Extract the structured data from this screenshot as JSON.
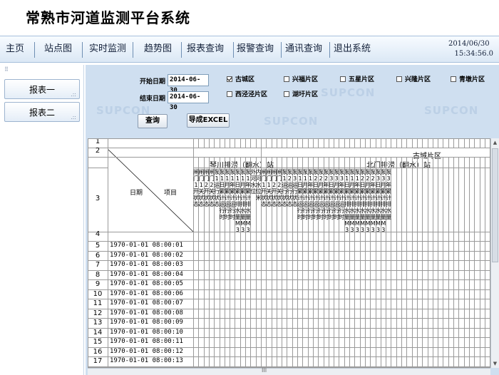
{
  "app": {
    "title": "常熟市河道监测平台系统"
  },
  "nav": {
    "items": [
      "主页",
      "站点图",
      "实时监测",
      "趋势图",
      "报表查询",
      "报警查询",
      "通讯查询",
      "退出系统"
    ],
    "date": "2014/06/30",
    "time": "15:34:56.0"
  },
  "sidebar": {
    "items": [
      "报表一",
      "报表二"
    ]
  },
  "watermark": "SUPCON",
  "form": {
    "start_label": "开始日期",
    "start_value": "2014-06-30",
    "end_label": "结束日期",
    "end_value": "2014-06-30",
    "districts": [
      {
        "label": "古城区",
        "checked": true
      },
      {
        "label": "兴福片区",
        "checked": false
      },
      {
        "label": "五星片区",
        "checked": false
      },
      {
        "label": "兴隆片区",
        "checked": false
      },
      {
        "label": "青墩片区",
        "checked": false
      },
      {
        "label": "西泾泾片区",
        "checked": false
      },
      {
        "label": "湖圩片区",
        "checked": false
      }
    ],
    "query_button": "查询",
    "export_button": "导成EXCEL"
  },
  "sheet": {
    "header_rows": [
      "1",
      "2",
      "3",
      "4"
    ],
    "district_title": "古城片区",
    "station1": "琴川排涝（翻水）站",
    "station2": "北门排涝（翻水）站",
    "diag_date": "日期",
    "diag_item": "项目",
    "station1_cols": [
      "闸门1开状态",
      "闸门1关状态",
      "闸门2开状态",
      "闸门2关状态",
      "泵1运行状态",
      "泵1日累计运行时",
      "泵1月累计运行时",
      "泵1年累计运行时",
      "泵1日累计排水量M3",
      "泵1月累计排水量M3",
      "泵1年累计排水量M3",
      "外河水位",
      "内河水位米"
    ],
    "station2_cols": [
      "闸门1开状态",
      "闸门1关状态",
      "闸门2开状态",
      "闸门2关状态",
      "泵1运行状态",
      "泵2运行状态",
      "泵3运行状态",
      "泵1日累计运行时",
      "泵1月累计运行时",
      "泵1年累计运行时",
      "泵2日累计运行时",
      "泵2月累计运行时",
      "泵2年累计运行时",
      "泵3日累计运行时",
      "泵3月累计运行时",
      "泵3年累计运行时",
      "泵1日累计排水量M3",
      "泵1月累计排水量M3",
      "泵1年累计排水量M3",
      "泵2日累计排水量M3",
      "泵2月累计排水量M3",
      "泵2年累计排水量M3",
      "泵3日累计排水量M3",
      "泵3月累计排水量M3",
      "泵3年累计排水量"
    ],
    "rows": [
      {
        "num": "5",
        "date": "1970-01-01 08:00:01"
      },
      {
        "num": "6",
        "date": "1970-01-01 08:00:02"
      },
      {
        "num": "7",
        "date": "1970-01-01 08:00:03"
      },
      {
        "num": "8",
        "date": "1970-01-01 08:00:04"
      },
      {
        "num": "9",
        "date": "1970-01-01 08:00:05"
      },
      {
        "num": "10",
        "date": "1970-01-01 08:00:06"
      },
      {
        "num": "11",
        "date": "1970-01-01 08:00:07"
      },
      {
        "num": "12",
        "date": "1970-01-01 08:00:08"
      },
      {
        "num": "13",
        "date": "1970-01-01 08:00:09"
      },
      {
        "num": "14",
        "date": "1970-01-01 08:00:10"
      },
      {
        "num": "15",
        "date": "1970-01-01 08:00:11"
      },
      {
        "num": "16",
        "date": "1970-01-01 08:00:12"
      },
      {
        "num": "17",
        "date": "1970-01-01 08:00:13"
      }
    ]
  }
}
